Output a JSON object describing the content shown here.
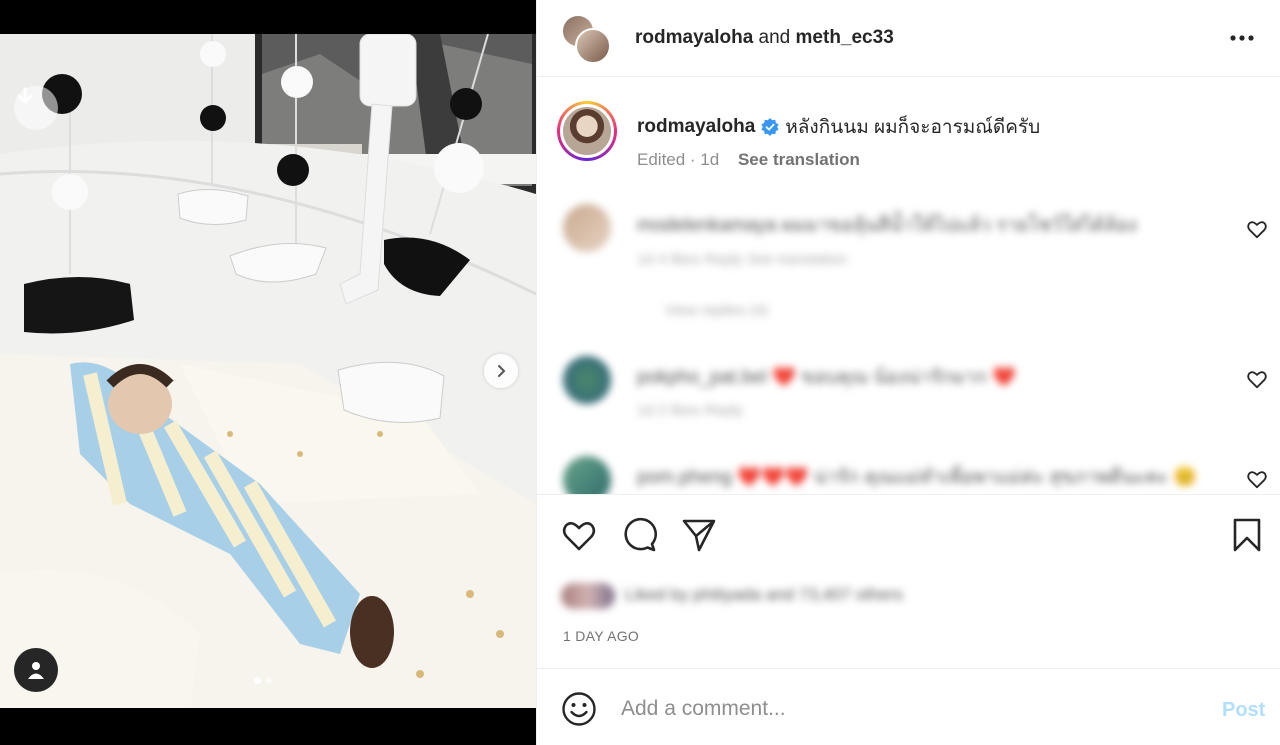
{
  "header": {
    "user1": "rodmayaloha",
    "conjunction": "and",
    "user2": "meth_ec33",
    "more_icon": "more-horizontal-icon"
  },
  "caption": {
    "username": "rodmayaloha",
    "verified": true,
    "text": "หลังกินนม ผมก็จะอารมณ์ดีครับ",
    "edited": "Edited · 1d",
    "see_translation": "See translation"
  },
  "comments": [
    {
      "username": "modelenkamaya",
      "text": "modelenkamaya ผมมาขอลุ้นสีน้ำให้ไปแล้ว รายโชว์ใส่ได้ล้อง",
      "meta": "1d   4 likes   Reply   See translation",
      "replies": "View replies (4)"
    },
    {
      "username": "pokpho_pat.bel",
      "text": "pokpho_pat.bel ❤️ ขอบคุณ น้องน่ารักมาก ❤️",
      "meta": "1d   2 likes   Reply"
    },
    {
      "username": "pompheng",
      "text": "pom.pheng ❤️❤️❤️ น่ารัก คุณแม่ทำเพื่อพาแม่ค่ะ สุขภาพดีนะคะ 😊"
    }
  ],
  "actions": {
    "like_icon": "heart-icon",
    "comment_icon": "comment-icon",
    "share_icon": "send-icon",
    "save_icon": "bookmark-icon"
  },
  "likes_text": "Liked by phitiyada and 73,407 others",
  "timestamp": "1 DAY AGO",
  "composer": {
    "placeholder": "Add a comment...",
    "post_label": "Post",
    "emoji_icon": "emoji-icon"
  },
  "carousel": {
    "current": 1,
    "total": 2
  },
  "colors": {
    "accent": "#0095f6",
    "post_disabled": "#b2dffc",
    "verified": "#3897f0"
  }
}
